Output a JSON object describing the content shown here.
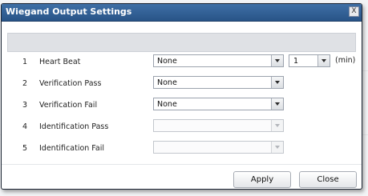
{
  "dialog": {
    "title": "Wiegand Output Settings",
    "close_glyph": "X"
  },
  "rows": [
    {
      "num": "1",
      "label": "Heart Beat",
      "value": "None",
      "enabled": true,
      "interval": "1",
      "interval_unit": "(min)"
    },
    {
      "num": "2",
      "label": "Verification Pass",
      "value": "None",
      "enabled": true
    },
    {
      "num": "3",
      "label": "Verification Fail",
      "value": "None",
      "enabled": true
    },
    {
      "num": "4",
      "label": "Identification Pass",
      "value": "",
      "enabled": false
    },
    {
      "num": "5",
      "label": "Identification Fail",
      "value": "",
      "enabled": false
    }
  ],
  "buttons": {
    "apply": "Apply",
    "close": "Close"
  },
  "colors": {
    "titlebar": "#3f6fa6",
    "header_band": "#dfe1e5"
  },
  "icons": {
    "dropdown": "chevron-down-icon",
    "close": "close-icon"
  }
}
